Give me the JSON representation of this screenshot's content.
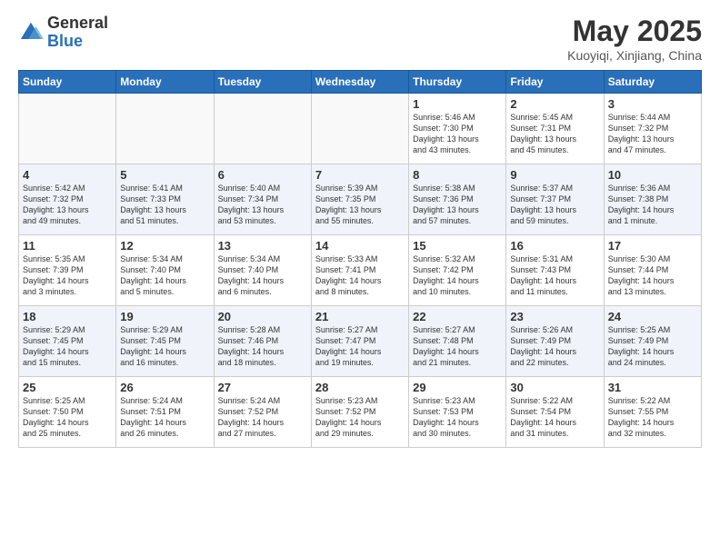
{
  "header": {
    "logo_general": "General",
    "logo_blue": "Blue",
    "title": "May 2025",
    "subtitle": "Kuoyiqi, Xinjiang, China"
  },
  "days_of_week": [
    "Sunday",
    "Monday",
    "Tuesday",
    "Wednesday",
    "Thursday",
    "Friday",
    "Saturday"
  ],
  "weeks": [
    [
      {
        "day": "",
        "info": ""
      },
      {
        "day": "",
        "info": ""
      },
      {
        "day": "",
        "info": ""
      },
      {
        "day": "",
        "info": ""
      },
      {
        "day": "1",
        "info": "Sunrise: 5:46 AM\nSunset: 7:30 PM\nDaylight: 13 hours\nand 43 minutes."
      },
      {
        "day": "2",
        "info": "Sunrise: 5:45 AM\nSunset: 7:31 PM\nDaylight: 13 hours\nand 45 minutes."
      },
      {
        "day": "3",
        "info": "Sunrise: 5:44 AM\nSunset: 7:32 PM\nDaylight: 13 hours\nand 47 minutes."
      }
    ],
    [
      {
        "day": "4",
        "info": "Sunrise: 5:42 AM\nSunset: 7:32 PM\nDaylight: 13 hours\nand 49 minutes."
      },
      {
        "day": "5",
        "info": "Sunrise: 5:41 AM\nSunset: 7:33 PM\nDaylight: 13 hours\nand 51 minutes."
      },
      {
        "day": "6",
        "info": "Sunrise: 5:40 AM\nSunset: 7:34 PM\nDaylight: 13 hours\nand 53 minutes."
      },
      {
        "day": "7",
        "info": "Sunrise: 5:39 AM\nSunset: 7:35 PM\nDaylight: 13 hours\nand 55 minutes."
      },
      {
        "day": "8",
        "info": "Sunrise: 5:38 AM\nSunset: 7:36 PM\nDaylight: 13 hours\nand 57 minutes."
      },
      {
        "day": "9",
        "info": "Sunrise: 5:37 AM\nSunset: 7:37 PM\nDaylight: 13 hours\nand 59 minutes."
      },
      {
        "day": "10",
        "info": "Sunrise: 5:36 AM\nSunset: 7:38 PM\nDaylight: 14 hours\nand 1 minute."
      }
    ],
    [
      {
        "day": "11",
        "info": "Sunrise: 5:35 AM\nSunset: 7:39 PM\nDaylight: 14 hours\nand 3 minutes."
      },
      {
        "day": "12",
        "info": "Sunrise: 5:34 AM\nSunset: 7:40 PM\nDaylight: 14 hours\nand 5 minutes."
      },
      {
        "day": "13",
        "info": "Sunrise: 5:34 AM\nSunset: 7:40 PM\nDaylight: 14 hours\nand 6 minutes."
      },
      {
        "day": "14",
        "info": "Sunrise: 5:33 AM\nSunset: 7:41 PM\nDaylight: 14 hours\nand 8 minutes."
      },
      {
        "day": "15",
        "info": "Sunrise: 5:32 AM\nSunset: 7:42 PM\nDaylight: 14 hours\nand 10 minutes."
      },
      {
        "day": "16",
        "info": "Sunrise: 5:31 AM\nSunset: 7:43 PM\nDaylight: 14 hours\nand 11 minutes."
      },
      {
        "day": "17",
        "info": "Sunrise: 5:30 AM\nSunset: 7:44 PM\nDaylight: 14 hours\nand 13 minutes."
      }
    ],
    [
      {
        "day": "18",
        "info": "Sunrise: 5:29 AM\nSunset: 7:45 PM\nDaylight: 14 hours\nand 15 minutes."
      },
      {
        "day": "19",
        "info": "Sunrise: 5:29 AM\nSunset: 7:45 PM\nDaylight: 14 hours\nand 16 minutes."
      },
      {
        "day": "20",
        "info": "Sunrise: 5:28 AM\nSunset: 7:46 PM\nDaylight: 14 hours\nand 18 minutes."
      },
      {
        "day": "21",
        "info": "Sunrise: 5:27 AM\nSunset: 7:47 PM\nDaylight: 14 hours\nand 19 minutes."
      },
      {
        "day": "22",
        "info": "Sunrise: 5:27 AM\nSunset: 7:48 PM\nDaylight: 14 hours\nand 21 minutes."
      },
      {
        "day": "23",
        "info": "Sunrise: 5:26 AM\nSunset: 7:49 PM\nDaylight: 14 hours\nand 22 minutes."
      },
      {
        "day": "24",
        "info": "Sunrise: 5:25 AM\nSunset: 7:49 PM\nDaylight: 14 hours\nand 24 minutes."
      }
    ],
    [
      {
        "day": "25",
        "info": "Sunrise: 5:25 AM\nSunset: 7:50 PM\nDaylight: 14 hours\nand 25 minutes."
      },
      {
        "day": "26",
        "info": "Sunrise: 5:24 AM\nSunset: 7:51 PM\nDaylight: 14 hours\nand 26 minutes."
      },
      {
        "day": "27",
        "info": "Sunrise: 5:24 AM\nSunset: 7:52 PM\nDaylight: 14 hours\nand 27 minutes."
      },
      {
        "day": "28",
        "info": "Sunrise: 5:23 AM\nSunset: 7:52 PM\nDaylight: 14 hours\nand 29 minutes."
      },
      {
        "day": "29",
        "info": "Sunrise: 5:23 AM\nSunset: 7:53 PM\nDaylight: 14 hours\nand 30 minutes."
      },
      {
        "day": "30",
        "info": "Sunrise: 5:22 AM\nSunset: 7:54 PM\nDaylight: 14 hours\nand 31 minutes."
      },
      {
        "day": "31",
        "info": "Sunrise: 5:22 AM\nSunset: 7:55 PM\nDaylight: 14 hours\nand 32 minutes."
      }
    ]
  ]
}
